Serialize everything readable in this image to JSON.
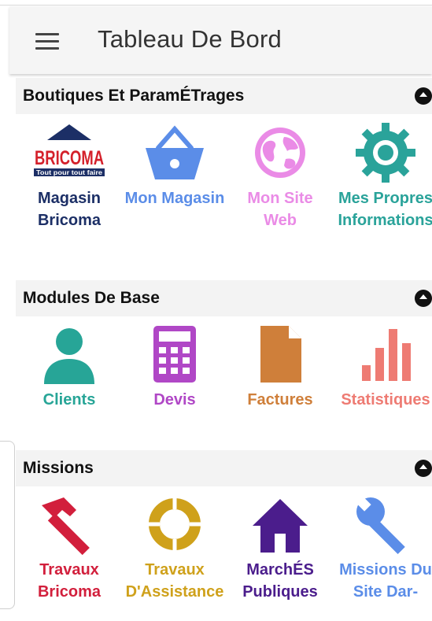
{
  "header": {
    "title": "Tableau De Bord"
  },
  "sections": [
    {
      "title": "Boutiques Et ParamÉTrages",
      "items": [
        {
          "label": "Magasin Bricoma",
          "icon": "bricoma-logo-icon",
          "color": "#1c2f66",
          "logo_text": "BRICOMA",
          "logo_tagline": "Tout pour tout faire"
        },
        {
          "label": "Mon Magasin",
          "icon": "basket-icon",
          "color": "#5b8de8"
        },
        {
          "label": "Mon Site Web",
          "icon": "globe-icon",
          "color": "#ea8be6"
        },
        {
          "label": "Mes Propres Informations",
          "icon": "gear-icon",
          "color": "#2aa39a"
        }
      ]
    },
    {
      "title": "Modules De Base",
      "items": [
        {
          "label": "Clients",
          "icon": "user-icon",
          "color": "#27a597"
        },
        {
          "label": "Devis",
          "icon": "calculator-icon",
          "color": "#b047c6"
        },
        {
          "label": "Factures",
          "icon": "file-icon",
          "color": "#cf7f3a"
        },
        {
          "label": "Statistiques",
          "icon": "bar-chart-icon",
          "color": "#ee7b73"
        }
      ]
    },
    {
      "title": "Missions",
      "items": [
        {
          "label": "Travaux Bricoma",
          "icon": "hammer-icon",
          "color": "#d21f3c"
        },
        {
          "label": "Travaux D'Assistance",
          "icon": "life-ring-icon",
          "color": "#cfa11b"
        },
        {
          "label": "MarchÉS Publiques",
          "icon": "home-icon",
          "color": "#4b1d8c"
        },
        {
          "label": "Missions Du Site Dar-",
          "icon": "wrench-icon",
          "color": "#5b8de8"
        }
      ]
    }
  ]
}
